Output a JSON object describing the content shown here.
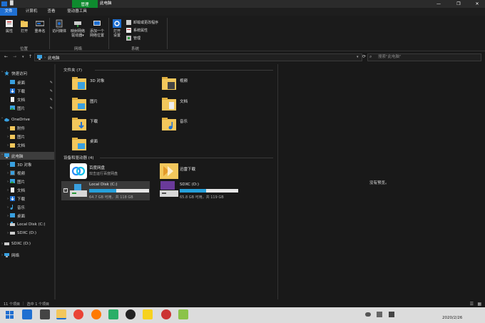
{
  "titlebar": {
    "ctx_tab": "管理",
    "title": "此电脑",
    "title_glyph": "█",
    "minimize": "—",
    "maximize": "❐",
    "close": "✕"
  },
  "menu_tabs": [
    "文件",
    "计算机",
    "查看",
    "驱动器工具"
  ],
  "ribbon": {
    "location": {
      "label": "位置",
      "buttons": [
        "属性",
        "打开",
        "重命名"
      ]
    },
    "network": {
      "label": "网络",
      "buttons": [
        "访问媒体",
        "映射网络\n驱动器▾",
        "添加一个\n网络位置"
      ]
    },
    "system": {
      "label": "系统",
      "open_settings": "打开\n设置",
      "small": [
        "卸载或更改程序",
        "系统属性",
        "管理"
      ]
    }
  },
  "address": {
    "path": "此电脑",
    "search_placeholder": "搜索\"此电脑\""
  },
  "nav": {
    "quick_access": "快速访问",
    "quick_items": [
      "桌面",
      "下载",
      "文档",
      "图片"
    ],
    "onedrive": "OneDrive",
    "onedrive_items": [
      "附件",
      "图片",
      "文档"
    ],
    "this_pc": "此电脑",
    "pc_items": [
      "3D 对象",
      "视频",
      "图片",
      "文档",
      "下载",
      "音乐",
      "桌面",
      "Local Disk (C:)",
      "SDXC (D:)"
    ],
    "sdxc": "SDXC (D:)",
    "network": "网络"
  },
  "content": {
    "folders_header": "文件夹 (7)",
    "folders": [
      "3D 对象",
      "视频",
      "图片",
      "文档",
      "下载",
      "音乐",
      "桌面"
    ],
    "devices_header": "设备和驱动器 (4)",
    "baidu": {
      "name": "百度网盘",
      "sub": "双击运行百度网盘"
    },
    "xunlei": {
      "name": "迅雷下载"
    },
    "disk_c": {
      "name": "Local Disk (C:)",
      "free": "64.7 GB 可用，共 118 GB",
      "used_fraction": 0.45
    },
    "disk_d": {
      "name": "SDXC (D:)",
      "free": "65.8 GB 可用，共 119 GB",
      "used_fraction": 0.45
    }
  },
  "preview": {
    "text": "没有预览。"
  },
  "status": {
    "items": "11 个项目",
    "selected": "选中 1 个项目"
  },
  "taskbar": {
    "date": "2020/2/26"
  },
  "colors": {
    "accent": "#1f6fd1",
    "ctx_green": "#0e8a2e",
    "bar_fill": "#26a0da",
    "folder": "#f2c75c"
  }
}
